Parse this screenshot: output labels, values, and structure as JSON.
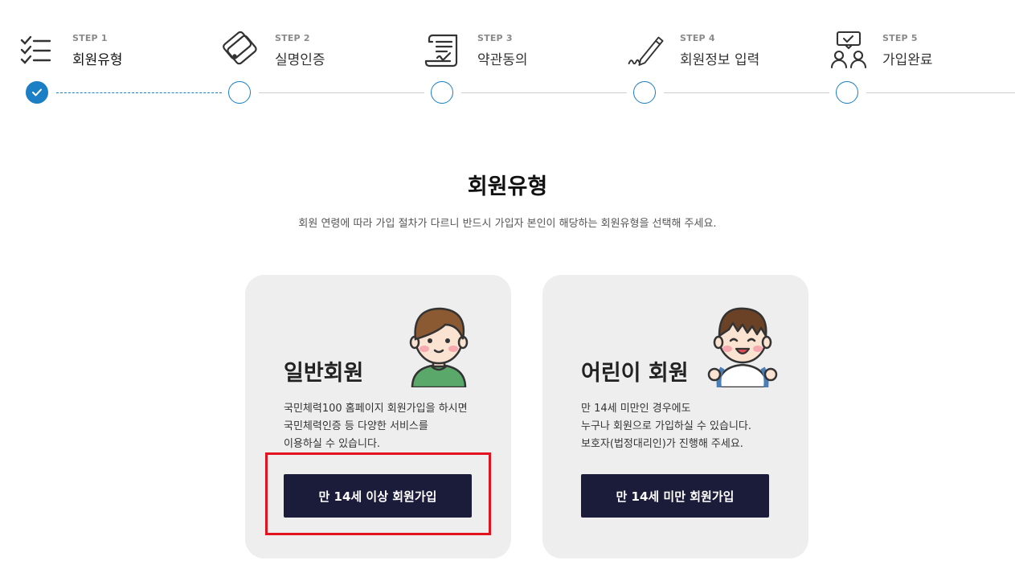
{
  "steps": [
    {
      "small": "STEP 1",
      "label": "회원유형",
      "icon": "checklist-icon",
      "status": "done"
    },
    {
      "small": "STEP 2",
      "label": "실명인증",
      "icon": "phone-card-icon",
      "status": "pending"
    },
    {
      "small": "STEP 3",
      "label": "약관동의",
      "icon": "scroll-document-icon",
      "status": "pending"
    },
    {
      "small": "STEP 4",
      "label": "회원정보 입력",
      "icon": "pen-signature-icon",
      "status": "pending"
    },
    {
      "small": "STEP 5",
      "label": "가입완료",
      "icon": "users-check-icon",
      "status": "pending"
    }
  ],
  "page": {
    "title": "회원유형",
    "subtitle": "회원 연령에 따라 가입 절차가 다르니 반드시 가입자 본인이 해당하는 회원유형을 선택해 주세요."
  },
  "cards": [
    {
      "title": "일반회원",
      "desc_lines": [
        "국민체력100 홈페이지 회원가입을 하시면",
        "국민체력인증 등 다양한 서비스를",
        "이용하실 수 있습니다."
      ],
      "button": "만 14세 이상 회원가입",
      "avatar": "adult-avatar-icon"
    },
    {
      "title": "어린이 회원",
      "desc_lines": [
        "만 14세 미만인 경우에도",
        "누구나 회원으로 가입하실 수 있습니다.",
        "보호자(법정대리인)가 진행해 주세요."
      ],
      "button": "만 14세 미만 회원가입",
      "avatar": "child-avatar-icon"
    }
  ],
  "colors": {
    "accent": "#1a7fc4",
    "button_bg": "#1b1c3a",
    "card_bg": "#eeeeee",
    "highlight": "#e3121f"
  }
}
